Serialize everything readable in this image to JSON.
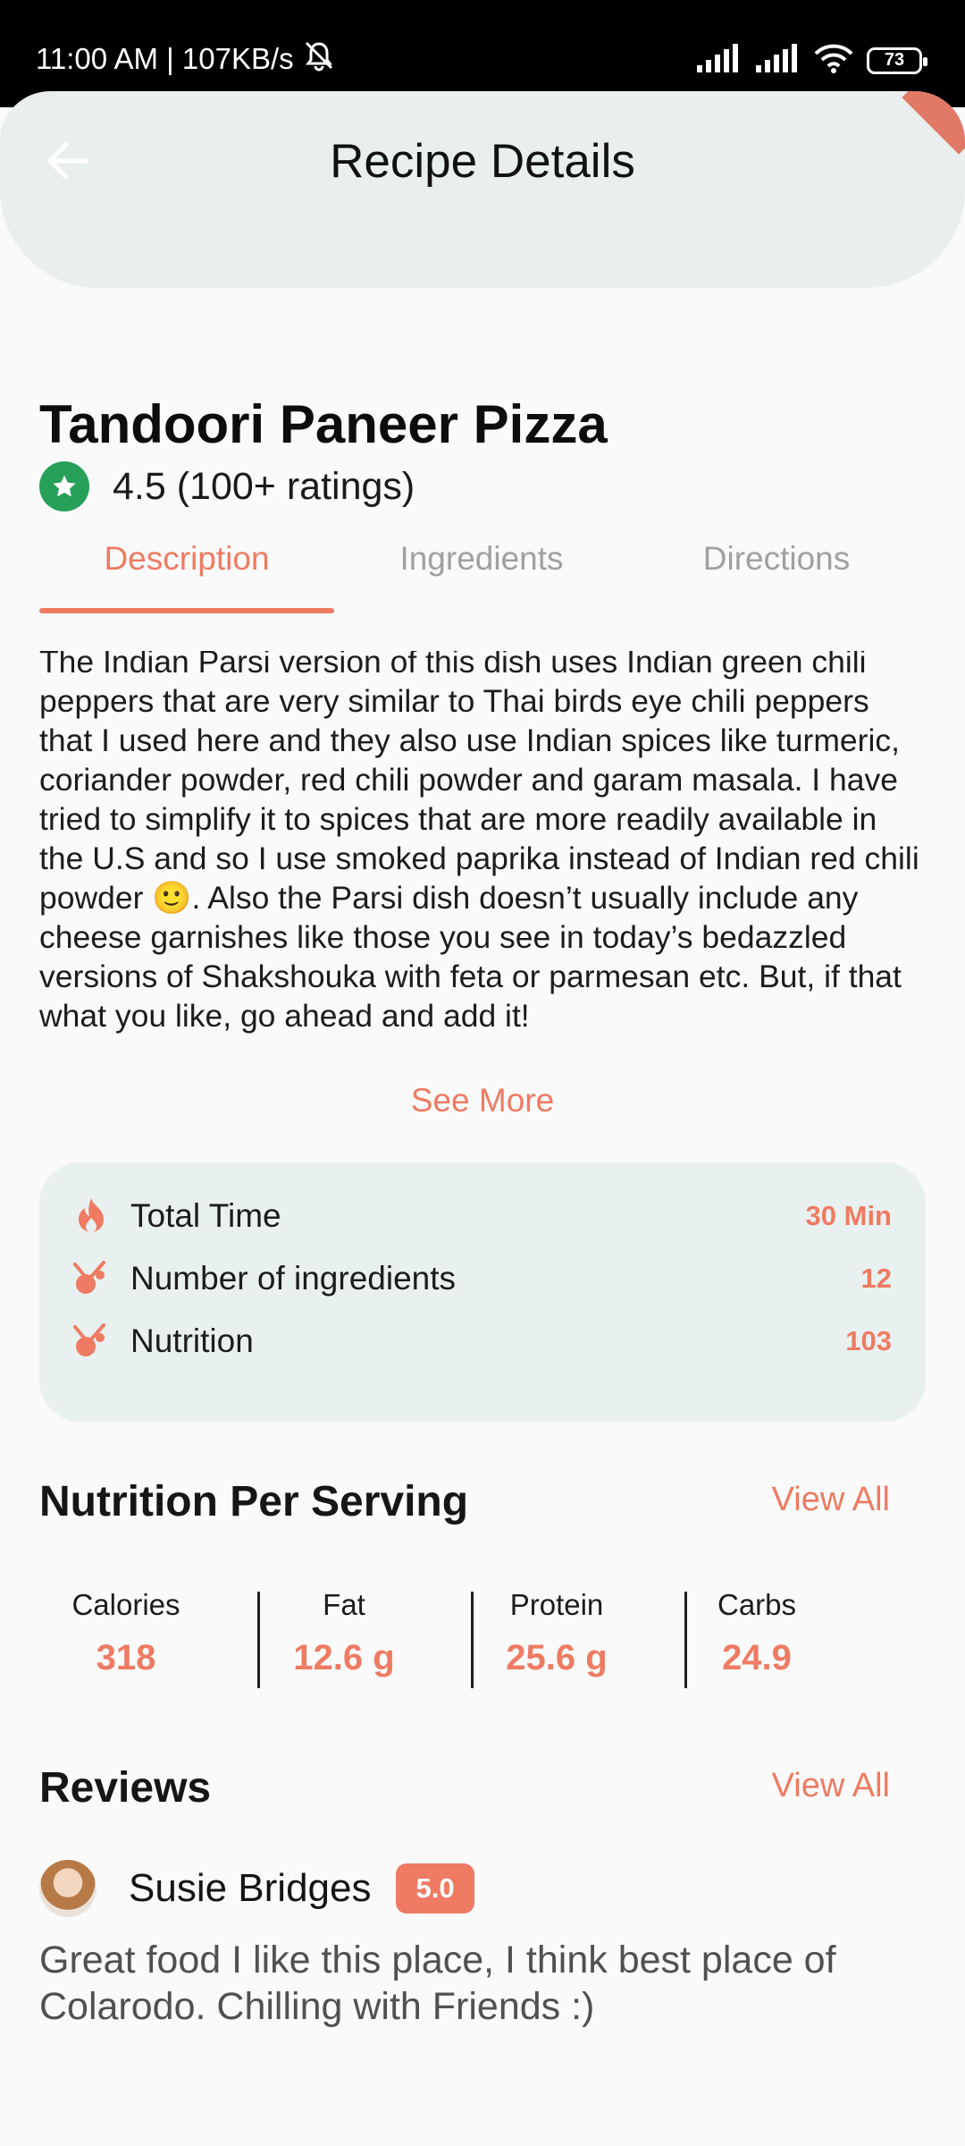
{
  "status_bar": {
    "left_text": "11:00 AM | 107KB/s",
    "battery": "73"
  },
  "header": {
    "title": "Recipe Details"
  },
  "recipe": {
    "title": "Tandoori Paneer Pizza",
    "rating_text": "4.5 (100+ ratings)"
  },
  "tabs": [
    {
      "label": "Description",
      "active": true
    },
    {
      "label": "Ingredients",
      "active": false
    },
    {
      "label": "Directions",
      "active": false
    }
  ],
  "description": {
    "text": "The Indian Parsi version of this dish uses Indian green chili peppers that are very similar to Thai birds eye chili peppers that I used here and they also use Indian spices like turmeric, coriander powder, red chili powder and garam masala. I have tried to simplify it to spices that are more readily available in the U.S and so I use smoked paprika instead of Indian red chili powder 🙂.  Also the Parsi dish doesn’t usually include any cheese garnishes like those you see in today’s bedazzled versions of Shakshouka with feta or parmesan etc. But, if that what you like, go ahead and add it!",
    "see_more": "See More"
  },
  "info": [
    {
      "icon": "flame-icon",
      "label": "Total Time",
      "value": "30 Min"
    },
    {
      "icon": "ingredients-icon",
      "label": "Number of ingredients",
      "value": "12"
    },
    {
      "icon": "nutrition-icon",
      "label": "Nutrition",
      "value": "103"
    }
  ],
  "nutrition": {
    "title": "Nutrition Per Serving",
    "view_all": "View All",
    "items": [
      {
        "label": "Calories",
        "value": "318"
      },
      {
        "label": "Fat",
        "value": "12.6 g"
      },
      {
        "label": "Protein",
        "value": "25.6 g"
      },
      {
        "label": "Carbs",
        "value": "24.9"
      }
    ]
  },
  "reviews": {
    "title": "Reviews",
    "view_all": "View All",
    "items": [
      {
        "name": "Susie Bridges",
        "score": "5.0",
        "text": "Great food I like this place, I think best place of Colarodo. Chilling with Friends :)"
      }
    ]
  },
  "colors": {
    "accent": "#ee7b62",
    "rating_green": "#27a05a",
    "card_bg": "#e9f1f0",
    "header_bg": "#e9efee"
  }
}
